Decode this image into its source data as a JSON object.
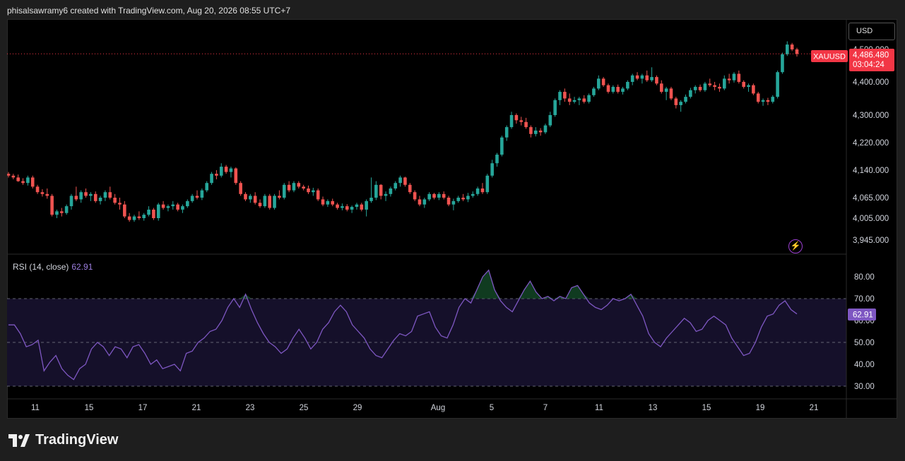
{
  "header": {
    "attribution": "phisalsawramy6 created with TradingView.com, Aug 20, 2026 08:55 UTC+7"
  },
  "currency_button": {
    "label": "USD"
  },
  "price_badge": {
    "symbol": "XAUUSD",
    "price": "4,486.480",
    "countdown": "03:04:24",
    "color": "#f23645"
  },
  "rsi_legend": {
    "label": "RSI (14, close)",
    "value": "62.91"
  },
  "rsi_badge": {
    "value": "62.91",
    "color": "#7e57c2"
  },
  "logo": {
    "text": "TradingView"
  },
  "colors": {
    "up": "#26a69a",
    "down": "#ef5350",
    "rsi_line": "#7e57c2",
    "rsi_band": "#15102a",
    "background": "#000000"
  },
  "icons": {
    "alert": "lightning-bolt-icon"
  },
  "chart_data": [
    {
      "type": "candlestick",
      "x_ticks": [
        "11",
        "15",
        "17",
        "21",
        "23",
        "25",
        "29",
        "Aug",
        "5",
        "7",
        "11",
        "13",
        "15",
        "19",
        "21"
      ],
      "y_ticks": [
        "4,500.000",
        "4,400.000",
        "4,300.000",
        "4,220.000",
        "4,140.000",
        "4,065.000",
        "4,005.000",
        "3,945.000"
      ],
      "last_price": 4486.48,
      "candles": [
        [
          4130,
          4135,
          4120,
          4125
        ],
        [
          4125,
          4130,
          4115,
          4120
        ],
        [
          4120,
          4128,
          4108,
          4110
        ],
        [
          4110,
          4118,
          4100,
          4105
        ],
        [
          4105,
          4125,
          4098,
          4120
        ],
        [
          4120,
          4125,
          4090,
          4095
        ],
        [
          4095,
          4100,
          4075,
          4080
        ],
        [
          4080,
          4088,
          4068,
          4075
        ],
        [
          4075,
          4090,
          4062,
          4070
        ],
        [
          4070,
          4075,
          4010,
          4015
        ],
        [
          4015,
          4030,
          4005,
          4025
        ],
        [
          4025,
          4035,
          4010,
          4020
        ],
        [
          4020,
          4045,
          4015,
          4040
        ],
        [
          4040,
          4075,
          4030,
          4070
        ],
        [
          4070,
          4095,
          4055,
          4060
        ],
        [
          4060,
          4085,
          4050,
          4080
        ],
        [
          4080,
          4090,
          4065,
          4070
        ],
        [
          4070,
          4080,
          4055,
          4075
        ],
        [
          4075,
          4082,
          4050,
          4055
        ],
        [
          4055,
          4070,
          4045,
          4065
        ],
        [
          4065,
          4085,
          4055,
          4080
        ],
        [
          4080,
          4095,
          4060,
          4065
        ],
        [
          4065,
          4075,
          4045,
          4050
        ],
        [
          4050,
          4065,
          4030,
          4045
        ],
        [
          4045,
          4055,
          4005,
          4010
        ],
        [
          4010,
          4020,
          3995,
          4000
        ],
        [
          4000,
          4015,
          3995,
          4010
        ],
        [
          4010,
          4025,
          4000,
          4005
        ],
        [
          4005,
          4020,
          3998,
          4015
        ],
        [
          4015,
          4040,
          4010,
          4030
        ],
        [
          4030,
          4035,
          4000,
          4005
        ],
        [
          4005,
          4050,
          3998,
          4045
        ],
        [
          4045,
          4055,
          4030,
          4035
        ],
        [
          4035,
          4045,
          4025,
          4040
        ],
        [
          4040,
          4055,
          4030,
          4045
        ],
        [
          4045,
          4050,
          4025,
          4030
        ],
        [
          4030,
          4045,
          4020,
          4040
        ],
        [
          4040,
          4060,
          4035,
          4055
        ],
        [
          4055,
          4075,
          4050,
          4070
        ],
        [
          4070,
          4085,
          4060,
          4065
        ],
        [
          4065,
          4090,
          4058,
          4085
        ],
        [
          4085,
          4110,
          4080,
          4105
        ],
        [
          4105,
          4135,
          4100,
          4130
        ],
        [
          4130,
          4140,
          4115,
          4125
        ],
        [
          4125,
          4160,
          4120,
          4150
        ],
        [
          4150,
          4155,
          4130,
          4135
        ],
        [
          4135,
          4150,
          4120,
          4145
        ],
        [
          4145,
          4148,
          4100,
          4105
        ],
        [
          4105,
          4110,
          4070,
          4075
        ],
        [
          4075,
          4080,
          4055,
          4060
        ],
        [
          4060,
          4075,
          4050,
          4070
        ],
        [
          4070,
          4080,
          4045,
          4050
        ],
        [
          4050,
          4060,
          4035,
          4040
        ],
        [
          4040,
          4075,
          4035,
          4070
        ],
        [
          4070,
          4075,
          4030,
          4035
        ],
        [
          4035,
          4075,
          4030,
          4070
        ],
        [
          4070,
          4085,
          4060,
          4065
        ],
        [
          4065,
          4105,
          4060,
          4100
        ],
        [
          4100,
          4110,
          4080,
          4085
        ],
        [
          4085,
          4110,
          4080,
          4105
        ],
        [
          4105,
          4110,
          4090,
          4095
        ],
        [
          4095,
          4100,
          4085,
          4090
        ],
        [
          4090,
          4098,
          4075,
          4080
        ],
        [
          4080,
          4092,
          4070,
          4085
        ],
        [
          4085,
          4090,
          4055,
          4060
        ],
        [
          4060,
          4068,
          4040,
          4045
        ],
        [
          4045,
          4060,
          4038,
          4055
        ],
        [
          4055,
          4062,
          4040,
          4045
        ],
        [
          4045,
          4050,
          4030,
          4035
        ],
        [
          4035,
          4048,
          4028,
          4040
        ],
        [
          4040,
          4046,
          4025,
          4030
        ],
        [
          4030,
          4042,
          4020,
          4038
        ],
        [
          4038,
          4050,
          4030,
          4045
        ],
        [
          4045,
          4050,
          4025,
          4030
        ],
        [
          4030,
          4060,
          4010,
          4055
        ],
        [
          4055,
          4120,
          4050,
          4065
        ],
        [
          4065,
          4110,
          4058,
          4100
        ],
        [
          4100,
          4102,
          4060,
          4070
        ],
        [
          4070,
          4082,
          4055,
          4075
        ],
        [
          4075,
          4095,
          4068,
          4090
        ],
        [
          4090,
          4110,
          4085,
          4105
        ],
        [
          4105,
          4125,
          4095,
          4120
        ],
        [
          4120,
          4122,
          4095,
          4100
        ],
        [
          4100,
          4105,
          4075,
          4080
        ],
        [
          4080,
          4085,
          4055,
          4060
        ],
        [
          4060,
          4070,
          4040,
          4045
        ],
        [
          4045,
          4065,
          4035,
          4060
        ],
        [
          4060,
          4080,
          4055,
          4075
        ],
        [
          4075,
          4078,
          4060,
          4065
        ],
        [
          4065,
          4080,
          4058,
          4075
        ],
        [
          4075,
          4082,
          4060,
          4065
        ],
        [
          4065,
          4070,
          4040,
          4045
        ],
        [
          4045,
          4062,
          4028,
          4055
        ],
        [
          4055,
          4070,
          4050,
          4065
        ],
        [
          4065,
          4075,
          4055,
          4060
        ],
        [
          4060,
          4078,
          4052,
          4070
        ],
        [
          4070,
          4082,
          4065,
          4075
        ],
        [
          4075,
          4095,
          4070,
          4090
        ],
        [
          4090,
          4105,
          4075,
          4080
        ],
        [
          4080,
          4130,
          4075,
          4125
        ],
        [
          4125,
          4170,
          4120,
          4160
        ],
        [
          4160,
          4190,
          4150,
          4185
        ],
        [
          4185,
          4240,
          4180,
          4235
        ],
        [
          4235,
          4270,
          4225,
          4265
        ],
        [
          4265,
          4310,
          4260,
          4300
        ],
        [
          4300,
          4305,
          4275,
          4285
        ],
        [
          4285,
          4295,
          4270,
          4280
        ],
        [
          4280,
          4292,
          4260,
          4265
        ],
        [
          4265,
          4270,
          4235,
          4245
        ],
        [
          4245,
          4265,
          4238,
          4255
        ],
        [
          4255,
          4262,
          4240,
          4250
        ],
        [
          4250,
          4275,
          4245,
          4270
        ],
        [
          4270,
          4310,
          4265,
          4300
        ],
        [
          4300,
          4350,
          4295,
          4345
        ],
        [
          4345,
          4375,
          4330,
          4370
        ],
        [
          4370,
          4380,
          4340,
          4350
        ],
        [
          4350,
          4365,
          4330,
          4340
        ],
        [
          4340,
          4355,
          4335,
          4345
        ],
        [
          4345,
          4355,
          4330,
          4350
        ],
        [
          4350,
          4360,
          4335,
          4340
        ],
        [
          4340,
          4365,
          4335,
          4360
        ],
        [
          4360,
          4385,
          4355,
          4380
        ],
        [
          4380,
          4420,
          4375,
          4410
        ],
        [
          4410,
          4415,
          4385,
          4390
        ],
        [
          4390,
          4395,
          4365,
          4370
        ],
        [
          4370,
          4390,
          4365,
          4385
        ],
        [
          4385,
          4392,
          4365,
          4370
        ],
        [
          4370,
          4385,
          4362,
          4380
        ],
        [
          4380,
          4405,
          4375,
          4400
        ],
        [
          4400,
          4425,
          4390,
          4420
        ],
        [
          4420,
          4430,
          4405,
          4410
        ],
        [
          4410,
          4425,
          4395,
          4420
        ],
        [
          4420,
          4435,
          4400,
          4405
        ],
        [
          4405,
          4445,
          4400,
          4415
        ],
        [
          4415,
          4420,
          4390,
          4395
        ],
        [
          4395,
          4405,
          4365,
          4370
        ],
        [
          4370,
          4385,
          4345,
          4380
        ],
        [
          4380,
          4385,
          4345,
          4350
        ],
        [
          4350,
          4355,
          4320,
          4330
        ],
        [
          4330,
          4345,
          4310,
          4340
        ],
        [
          4340,
          4362,
          4335,
          4355
        ],
        [
          4355,
          4382,
          4350,
          4375
        ],
        [
          4375,
          4390,
          4365,
          4385
        ],
        [
          4385,
          4392,
          4370,
          4375
        ],
        [
          4375,
          4400,
          4370,
          4395
        ],
        [
          4395,
          4410,
          4385,
          4390
        ],
        [
          4390,
          4400,
          4375,
          4385
        ],
        [
          4385,
          4395,
          4370,
          4380
        ],
        [
          4380,
          4420,
          4375,
          4410
        ],
        [
          4410,
          4425,
          4395,
          4405
        ],
        [
          4405,
          4430,
          4398,
          4425
        ],
        [
          4425,
          4435,
          4395,
          4400
        ],
        [
          4400,
          4405,
          4380,
          4385
        ],
        [
          4385,
          4395,
          4370,
          4390
        ],
        [
          4390,
          4395,
          4360,
          4365
        ],
        [
          4365,
          4370,
          4335,
          4340
        ],
        [
          4340,
          4350,
          4328,
          4345
        ],
        [
          4345,
          4352,
          4330,
          4340
        ],
        [
          4340,
          4360,
          4335,
          4355
        ],
        [
          4355,
          4435,
          4350,
          4430
        ],
        [
          4430,
          4490,
          4425,
          4485
        ],
        [
          4485,
          4525,
          4480,
          4515
        ],
        [
          4515,
          4520,
          4495,
          4500
        ],
        [
          4500,
          4505,
          4478,
          4486
        ]
      ]
    },
    {
      "type": "line",
      "name": "RSI (14, close)",
      "y_ticks": [
        "80.00",
        "70.00",
        "60.00",
        "50.00",
        "40.00",
        "30.00"
      ],
      "bands": [
        70,
        50,
        30
      ],
      "ylim": [
        25,
        85
      ],
      "values": [
        58,
        58,
        54,
        48,
        49,
        51,
        37,
        41,
        44,
        38,
        35,
        33,
        38,
        40,
        47,
        50,
        48,
        44,
        48,
        47,
        43,
        48,
        49,
        45,
        40,
        42,
        38,
        39,
        40,
        37,
        45,
        46,
        50,
        52,
        55,
        56,
        60,
        66,
        70,
        66,
        72,
        65,
        59,
        54,
        50,
        48,
        45,
        47,
        52,
        56,
        52,
        47,
        50,
        56,
        59,
        64,
        67,
        64,
        58,
        55,
        52,
        47,
        44,
        43,
        47,
        51,
        54,
        53,
        55,
        62,
        63,
        64,
        57,
        53,
        52,
        58,
        66,
        70,
        68,
        74,
        80,
        83,
        74,
        69,
        66,
        64,
        69,
        74,
        78,
        73,
        70,
        71,
        69,
        71,
        70,
        75,
        76,
        72,
        68,
        66,
        65,
        67,
        70,
        69,
        70,
        72,
        67,
        62,
        54,
        50,
        48,
        52,
        55,
        58,
        61,
        59,
        55,
        56,
        60,
        62,
        60,
        58,
        52,
        48,
        44,
        45,
        50,
        57,
        62,
        63,
        67,
        69,
        65,
        63
      ]
    }
  ]
}
